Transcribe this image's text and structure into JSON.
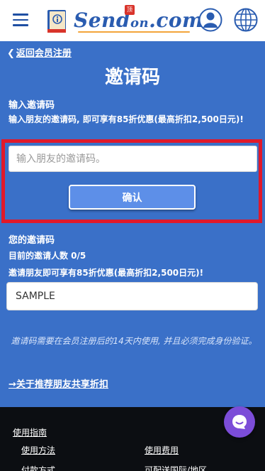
{
  "header": {
    "logo": {
      "main": "Send",
      "on": "on",
      "dot_com": ".com",
      "badge": "顶"
    },
    "icons": {
      "menu": "hamburger-icon",
      "book": "book-icon",
      "user": "user-icon",
      "globe": "globe-icon"
    },
    "colors": {
      "brand": "#2a5cb0",
      "accent": "#f3a53b"
    }
  },
  "back_link": {
    "chevron": "❮",
    "label": "返回会员注册"
  },
  "page_title": "邀请码",
  "enter_section": {
    "heading": "输入邀请码",
    "description": "输入朋友的邀请码, 即可享有85折优惠(最高折扣2,500日元)!",
    "input_placeholder": "输入朋友的邀请码。",
    "input_value": "",
    "confirm_label": "确认"
  },
  "my_section": {
    "heading": "您的邀请码",
    "count_text": "目前的邀请人数 0/5",
    "benefit_text": "邀请朋友即可享有85折优惠(最高折扣2,500日元)!",
    "code": "SAMPLE"
  },
  "note": "邀请码需要在会员注册后的14天内使用, 并且必须完成身份验证。",
  "referral_link": "→关于推荐朋友共享折扣",
  "footer": {
    "title": "使用指南",
    "links": [
      "使用方法",
      "使用费用",
      "付款方式",
      "可配送国际/地区"
    ]
  },
  "colors": {
    "page_bg": "#3a70c8",
    "highlight": "#e0192a",
    "button": "#5d8fe8",
    "footer_bg": "#0c0e12",
    "chat": "#7c4dd8"
  }
}
